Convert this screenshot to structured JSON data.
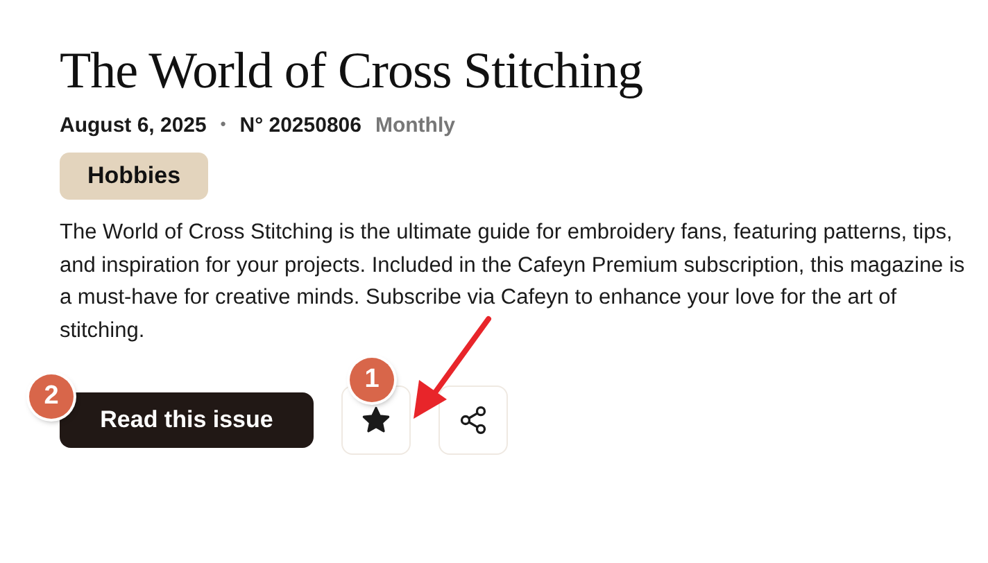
{
  "title": "The World of Cross Stitching",
  "meta": {
    "date": "August 6, 2025",
    "separator": "•",
    "issue": "N° 20250806",
    "frequency": "Monthly"
  },
  "tag": "Hobbies",
  "description": "The World of Cross Stitching is the ultimate guide for embroidery fans, featuring patterns, tips, and inspiration for your projects. Included in the Cafeyn Premium subscription, this magazine is a must-have for creative minds. Subscribe via Cafeyn to enhance your love for the art of stitching.",
  "actions": {
    "read_label": "Read this issue",
    "favorited": true
  },
  "annotations": [
    {
      "kind": "badge",
      "label": "2"
    },
    {
      "kind": "badge",
      "label": "1"
    },
    {
      "kind": "arrow"
    }
  ]
}
